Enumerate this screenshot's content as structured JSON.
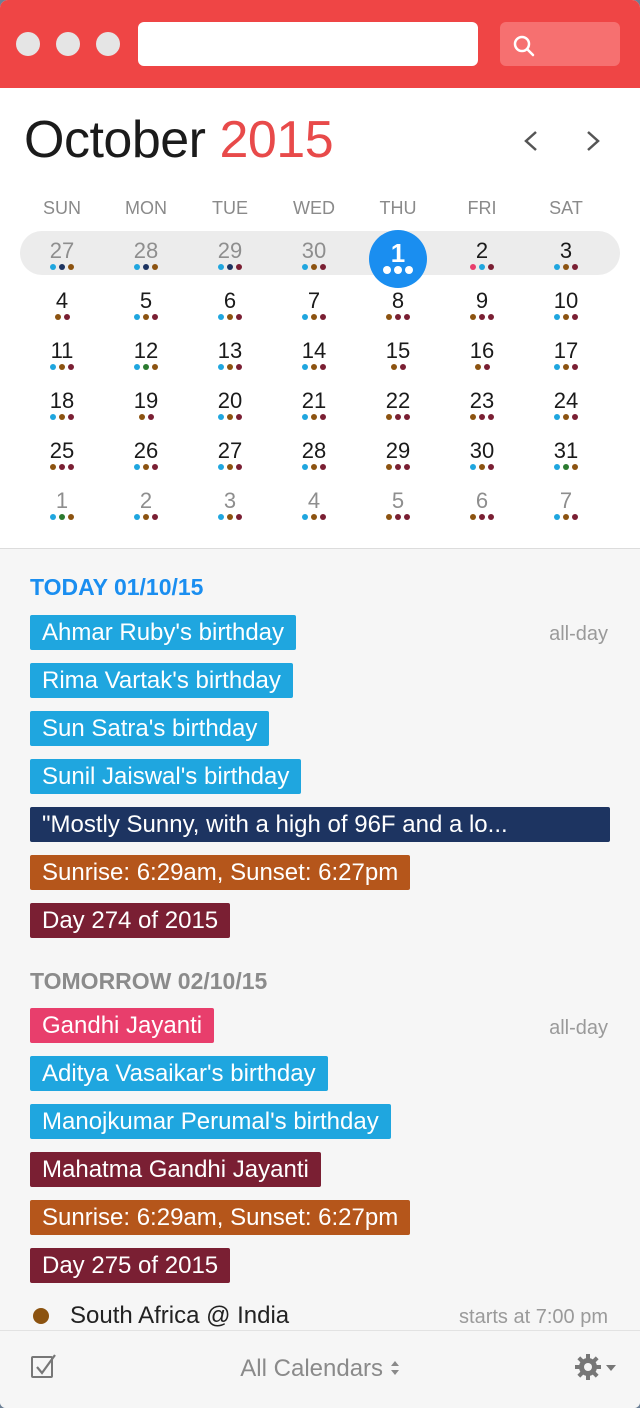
{
  "search": {
    "placeholder": ""
  },
  "calendar": {
    "month": "October",
    "year": "2015",
    "weekdays": [
      "SUN",
      "MON",
      "TUE",
      "WED",
      "THU",
      "FRI",
      "SAT"
    ],
    "weeks": [
      [
        {
          "d": "27",
          "dim": true,
          "dots": [
            "#1fa6df",
            "#1d3461",
            "#8c5310"
          ]
        },
        {
          "d": "28",
          "dim": true,
          "dots": [
            "#1fa6df",
            "#1d3461",
            "#8c5310"
          ]
        },
        {
          "d": "29",
          "dim": true,
          "dots": [
            "#1fa6df",
            "#1d3461",
            "#7a1f33"
          ]
        },
        {
          "d": "30",
          "dim": true,
          "dots": [
            "#1fa6df",
            "#8c5310",
            "#7a1f33"
          ]
        },
        {
          "d": "1",
          "today": true,
          "dots": [
            "#fff",
            "#fff",
            "#fff"
          ]
        },
        {
          "d": "2",
          "dots": [
            "#e83e6c",
            "#1fa6df",
            "#7a1f33"
          ]
        },
        {
          "d": "3",
          "dots": [
            "#1fa6df",
            "#8c5310",
            "#7a1f33"
          ]
        }
      ],
      [
        {
          "d": "4",
          "dots": [
            "#8c5310",
            "#7a1f33"
          ]
        },
        {
          "d": "5",
          "dots": [
            "#1fa6df",
            "#8c5310",
            "#7a1f33"
          ]
        },
        {
          "d": "6",
          "dots": [
            "#1fa6df",
            "#8c5310",
            "#7a1f33"
          ]
        },
        {
          "d": "7",
          "dots": [
            "#1fa6df",
            "#8c5310",
            "#7a1f33"
          ]
        },
        {
          "d": "8",
          "dots": [
            "#8c5310",
            "#7a1f33",
            "#7a1f33"
          ]
        },
        {
          "d": "9",
          "dots": [
            "#8c5310",
            "#7a1f33",
            "#7a1f33"
          ]
        },
        {
          "d": "10",
          "dots": [
            "#1fa6df",
            "#8c5310",
            "#7a1f33"
          ]
        }
      ],
      [
        {
          "d": "11",
          "dots": [
            "#1fa6df",
            "#8c5310",
            "#7a1f33"
          ]
        },
        {
          "d": "12",
          "dots": [
            "#1fa6df",
            "#2b7a2f",
            "#8c5310"
          ]
        },
        {
          "d": "13",
          "dots": [
            "#1fa6df",
            "#8c5310",
            "#7a1f33"
          ]
        },
        {
          "d": "14",
          "dots": [
            "#1fa6df",
            "#8c5310",
            "#7a1f33"
          ]
        },
        {
          "d": "15",
          "dots": [
            "#8c5310",
            "#7a1f33"
          ]
        },
        {
          "d": "16",
          "dots": [
            "#8c5310",
            "#7a1f33"
          ]
        },
        {
          "d": "17",
          "dots": [
            "#1fa6df",
            "#8c5310",
            "#7a1f33"
          ]
        }
      ],
      [
        {
          "d": "18",
          "dots": [
            "#1fa6df",
            "#8c5310",
            "#7a1f33"
          ]
        },
        {
          "d": "19",
          "dots": [
            "#8c5310",
            "#7a1f33"
          ]
        },
        {
          "d": "20",
          "dots": [
            "#1fa6df",
            "#8c5310",
            "#7a1f33"
          ]
        },
        {
          "d": "21",
          "dots": [
            "#1fa6df",
            "#8c5310",
            "#7a1f33"
          ]
        },
        {
          "d": "22",
          "dots": [
            "#8c5310",
            "#7a1f33",
            "#7a1f33"
          ]
        },
        {
          "d": "23",
          "dots": [
            "#8c5310",
            "#7a1f33",
            "#7a1f33"
          ]
        },
        {
          "d": "24",
          "dots": [
            "#1fa6df",
            "#8c5310",
            "#7a1f33"
          ]
        }
      ],
      [
        {
          "d": "25",
          "dots": [
            "#8c5310",
            "#7a1f33",
            "#7a1f33"
          ]
        },
        {
          "d": "26",
          "dots": [
            "#1fa6df",
            "#8c5310",
            "#7a1f33"
          ]
        },
        {
          "d": "27",
          "dots": [
            "#1fa6df",
            "#8c5310",
            "#7a1f33"
          ]
        },
        {
          "d": "28",
          "dots": [
            "#1fa6df",
            "#8c5310",
            "#7a1f33"
          ]
        },
        {
          "d": "29",
          "dots": [
            "#8c5310",
            "#7a1f33",
            "#7a1f33"
          ]
        },
        {
          "d": "30",
          "dots": [
            "#1fa6df",
            "#8c5310",
            "#7a1f33"
          ]
        },
        {
          "d": "31",
          "dots": [
            "#1fa6df",
            "#2b7a2f",
            "#8c5310"
          ]
        }
      ],
      [
        {
          "d": "1",
          "dim": true,
          "dots": [
            "#1fa6df",
            "#2b7a2f",
            "#8c5310"
          ]
        },
        {
          "d": "2",
          "dim": true,
          "dots": [
            "#1fa6df",
            "#8c5310",
            "#7a1f33"
          ]
        },
        {
          "d": "3",
          "dim": true,
          "dots": [
            "#1fa6df",
            "#8c5310",
            "#7a1f33"
          ]
        },
        {
          "d": "4",
          "dim": true,
          "dots": [
            "#1fa6df",
            "#8c5310",
            "#7a1f33"
          ]
        },
        {
          "d": "5",
          "dim": true,
          "dots": [
            "#8c5310",
            "#7a1f33",
            "#7a1f33"
          ]
        },
        {
          "d": "6",
          "dim": true,
          "dots": [
            "#8c5310",
            "#7a1f33",
            "#7a1f33"
          ]
        },
        {
          "d": "7",
          "dim": true,
          "dots": [
            "#1fa6df",
            "#8c5310",
            "#7a1f33"
          ]
        }
      ]
    ]
  },
  "agenda": {
    "today_header": "TODAY 01/10/15",
    "tomorrow_header": "TOMORROW 02/10/15",
    "allday_label": "all-day",
    "today_events": [
      {
        "title": "Ahmar Ruby's birthday",
        "color": "#1fa6df"
      },
      {
        "title": "Rima Vartak's birthday",
        "color": "#1fa6df"
      },
      {
        "title": "Sun Satra's birthday",
        "color": "#1fa6df"
      },
      {
        "title": "Sunil Jaiswal's birthday",
        "color": "#1fa6df"
      },
      {
        "title": "\"Mostly Sunny, with a high of 96F and a lo...",
        "color": "#1d3461"
      },
      {
        "title": "Sunrise: 6:29am, Sunset: 6:27pm",
        "color": "#b5561b"
      },
      {
        "title": "Day 274 of 2015",
        "color": "#7a1f33"
      }
    ],
    "tomorrow_events": [
      {
        "title": "Gandhi Jayanti",
        "color": "#e83e6c"
      },
      {
        "title": "Aditya Vasaikar's birthday",
        "color": "#1fa6df"
      },
      {
        "title": "Manojkumar Perumal's birthday",
        "color": "#1fa6df"
      },
      {
        "title": "Mahatma Gandhi Jayanti",
        "color": "#7a1f33"
      },
      {
        "title": "Sunrise: 6:29am, Sunset: 6:27pm",
        "color": "#b5561b"
      },
      {
        "title": "Day 275 of 2015",
        "color": "#7a1f33"
      }
    ],
    "timed_event": {
      "title": "South Africa @ India",
      "time": "starts at 7:00 pm",
      "color": "#8c5310"
    }
  },
  "footer": {
    "calendars_label": "All Calendars"
  }
}
